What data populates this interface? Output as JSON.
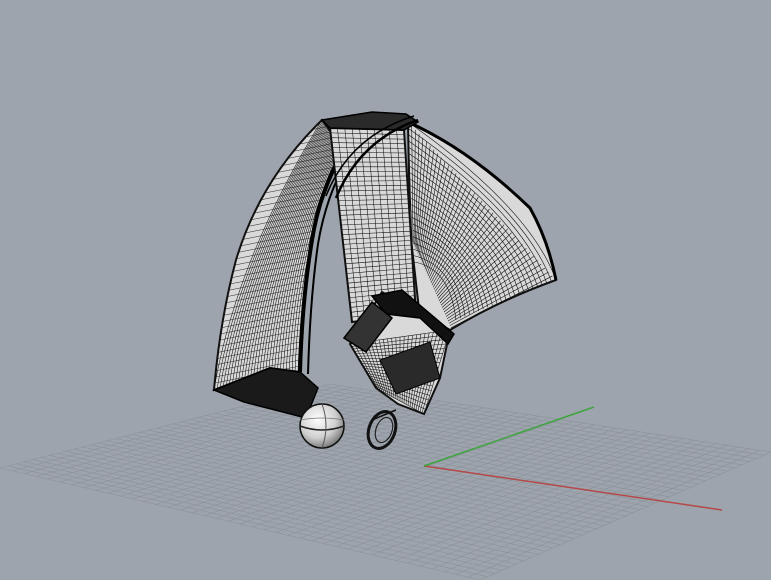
{
  "viewport": {
    "view": "perspective",
    "background_color": "#9ea4ad",
    "grid_color": "#8c9299",
    "x_axis_color": "#b54848",
    "y_axis_color": "#3ea53e",
    "mesh_fill_color": "#d9d9d9",
    "mesh_line_color": "#111111"
  },
  "scene_objects": [
    {
      "name": "curved-fan-panel-mesh",
      "kind": "surface-mesh"
    },
    {
      "name": "left-quarter-arc-mesh",
      "kind": "surface-mesh"
    },
    {
      "name": "central-tall-plate-mesh",
      "kind": "surface-mesh"
    },
    {
      "name": "lower-blade-assembly-mesh",
      "kind": "surface-mesh"
    },
    {
      "name": "sphere-object",
      "kind": "sphere"
    },
    {
      "name": "ring-object",
      "kind": "torus"
    }
  ]
}
